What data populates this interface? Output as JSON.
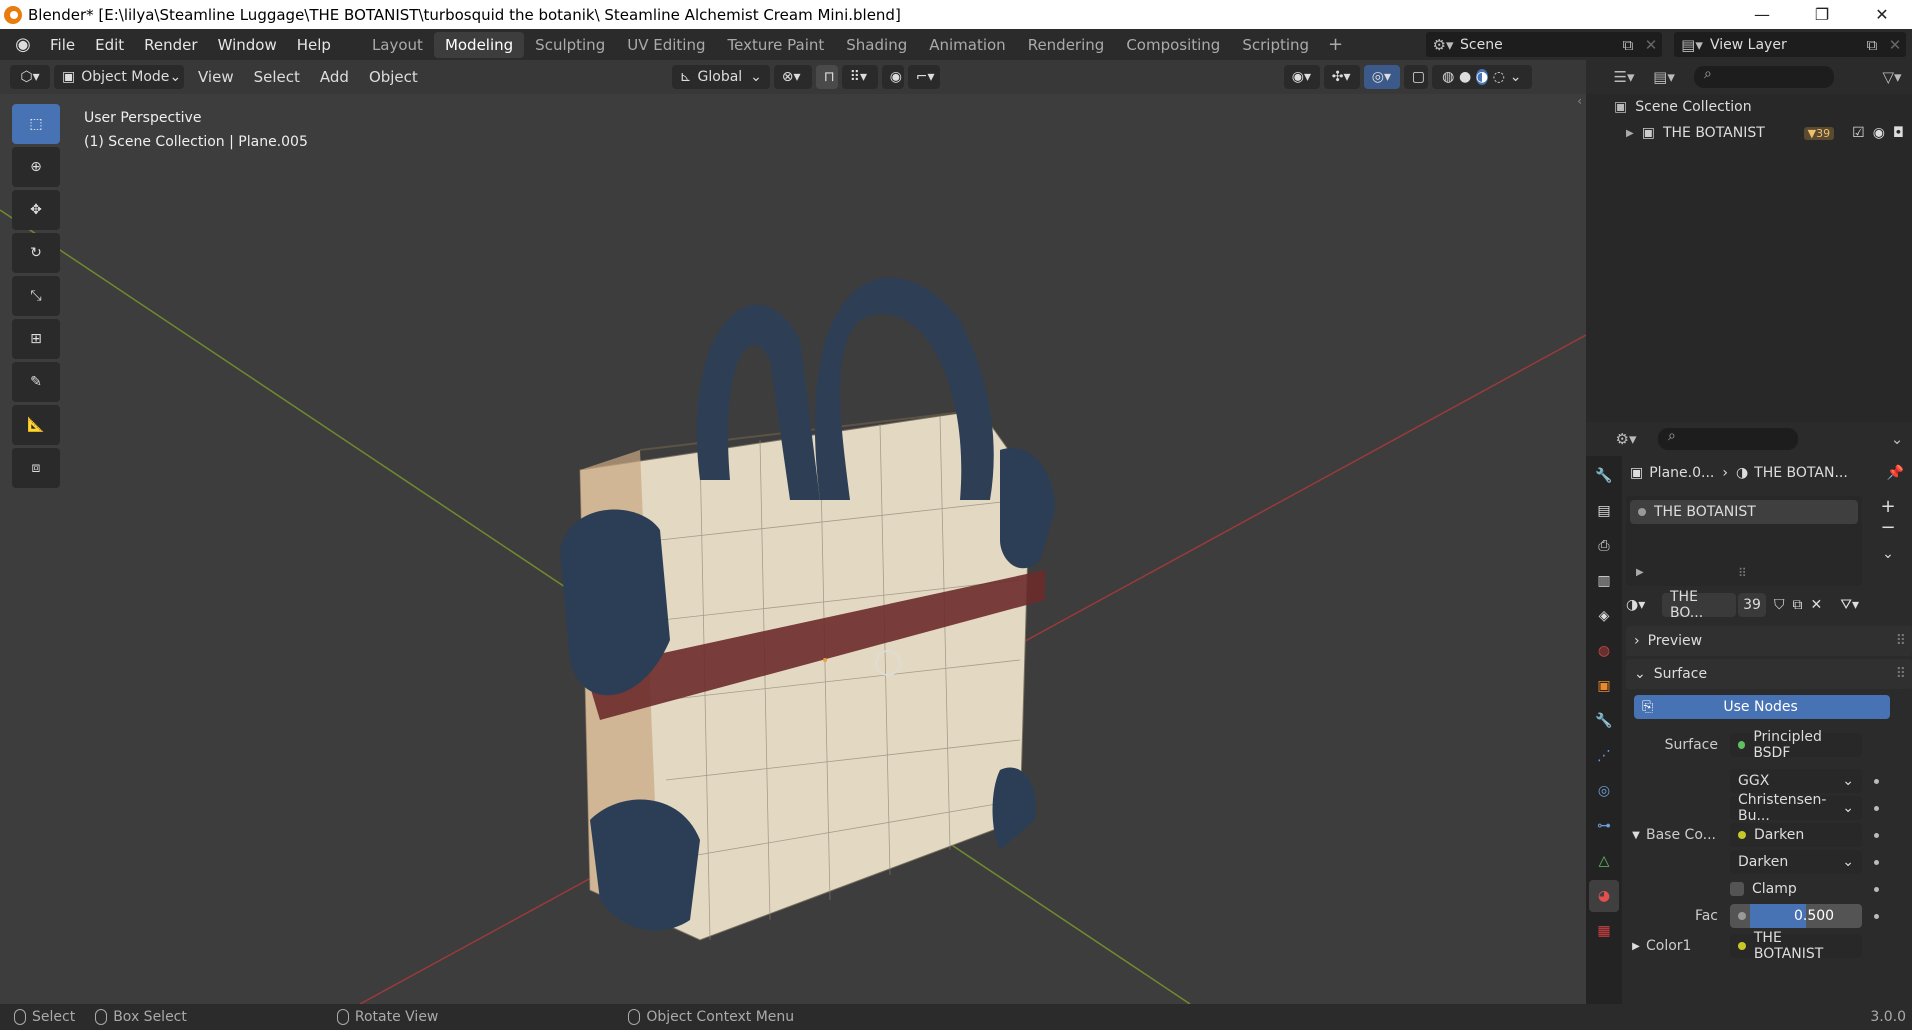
{
  "window": {
    "title": "Blender* [E:\\lilya\\Steamline Luggage\\THE BOTANIST\\turbosquid the botanik\\ Steamline Alchemist Cream Mini.blend]",
    "minimize": "—",
    "maximize": "❐",
    "close": "✕"
  },
  "menu": [
    "File",
    "Edit",
    "Render",
    "Window",
    "Help"
  ],
  "workspaces": [
    {
      "label": "Layout",
      "active": false
    },
    {
      "label": "Modeling",
      "active": true
    },
    {
      "label": "Sculpting",
      "active": false
    },
    {
      "label": "UV Editing",
      "active": false
    },
    {
      "label": "Texture Paint",
      "active": false
    },
    {
      "label": "Shading",
      "active": false
    },
    {
      "label": "Animation",
      "active": false
    },
    {
      "label": "Rendering",
      "active": false
    },
    {
      "label": "Compositing",
      "active": false
    },
    {
      "label": "Scripting",
      "active": false
    }
  ],
  "add_workspace": "+",
  "scene": {
    "name": "Scene"
  },
  "view_layer": {
    "name": "View Layer"
  },
  "viewport_header": {
    "mode": "Object Mode",
    "menus": [
      "View",
      "Select",
      "Add",
      "Object"
    ],
    "transform_orientation": "Global"
  },
  "viewport": {
    "perspective": "User Perspective",
    "collection_info": "(1) Scene Collection | Plane.005"
  },
  "tools": [
    "select-box",
    "cursor",
    "move",
    "rotate",
    "scale",
    "transform",
    "annotate",
    "measure",
    "add-cube"
  ],
  "outliner": {
    "root": "Scene Collection",
    "items": [
      {
        "label": "THE BOTANIST",
        "badge": "39"
      }
    ]
  },
  "properties": {
    "breadcrumb_object": "Plane.0...",
    "breadcrumb_material": "THE BOTAN...",
    "material_slot": "THE BOTANIST",
    "material_name": "THE BO...",
    "user_count": "39",
    "preview_label": "Preview",
    "surface_label": "Surface",
    "use_nodes": "Use Nodes",
    "surface_field_label": "Surface",
    "surface_shader": "Principled BSDF",
    "distribution": "GGX",
    "subsurface_method": "Christensen-Bu...",
    "base_color_label": "Base Co...",
    "base_color_node": "Darken",
    "blend_mode": "Darken",
    "clamp_label": "Clamp",
    "fac_label": "Fac",
    "fac_value": "0.500",
    "fac": 0.5,
    "color1_label": "Color1",
    "color1_value": "THE BOTANIST"
  },
  "statusbar": {
    "select": "Select",
    "box_select": "Box Select",
    "rotate_view": "Rotate View",
    "context_menu": "Object Context Menu",
    "version": "3.0.0"
  },
  "colors": {
    "accent": "#4772b3",
    "viewport_bg": "#3d3d3d",
    "x_axis": "#9a3a3a",
    "y_axis": "#6e8b2f"
  }
}
